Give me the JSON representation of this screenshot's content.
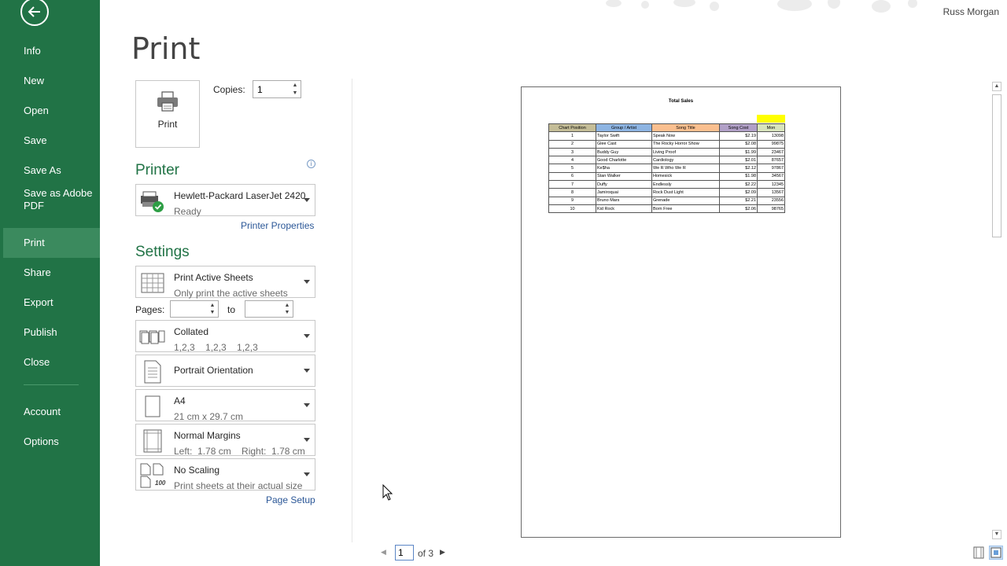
{
  "sidebar": {
    "back_icon": "arrow-left-icon",
    "items": [
      {
        "label": "Info"
      },
      {
        "label": "New"
      },
      {
        "label": "Open"
      },
      {
        "label": "Save"
      },
      {
        "label": "Save As"
      },
      {
        "label": "Save as Adobe PDF"
      },
      {
        "label": "Print"
      },
      {
        "label": "Share"
      },
      {
        "label": "Export"
      },
      {
        "label": "Publish"
      },
      {
        "label": "Close"
      },
      {
        "label": "Account"
      },
      {
        "label": "Options"
      }
    ],
    "active_item": "Print",
    "accent_color": "#217346"
  },
  "header": {
    "title": "Print",
    "user": "Russ Morgan"
  },
  "print_button": {
    "label": "Print",
    "icon": "printer-icon"
  },
  "copies": {
    "label": "Copies:",
    "value": "1"
  },
  "printer": {
    "section_title": "Printer",
    "name": "Hewlett-Packard LaserJet 2420",
    "status": "Ready",
    "properties_link": "Printer Properties"
  },
  "settings": {
    "section_title": "Settings",
    "what_to_print": {
      "title": "Print Active Sheets",
      "subtitle": "Only print the active sheets"
    },
    "pages": {
      "label": "Pages:",
      "to_label": "to",
      "from": "",
      "to": ""
    },
    "collation": {
      "title": "Collated",
      "subtitle": "1,2,3    1,2,3    1,2,3"
    },
    "orientation": {
      "title": "Portrait Orientation"
    },
    "paper": {
      "title": "A4",
      "subtitle": "21 cm x 29.7 cm"
    },
    "margins": {
      "title": "Normal Margins",
      "subtitle": "Left:  1.78 cm    Right:  1.78 cm"
    },
    "scaling": {
      "title": "No Scaling",
      "subtitle": "Print sheets at their actual size",
      "icon_text": "100"
    },
    "page_setup_link": "Page Setup"
  },
  "preview": {
    "sheet_title": "Total Sales",
    "columns": [
      "Chart Position",
      "Group / Artist",
      "Song Title",
      "Song Cost",
      "Mon"
    ],
    "rows": [
      [
        "1",
        "Taylor Swift",
        "Speak Now",
        "$2.19",
        "13098"
      ],
      [
        "2",
        "Glee Cast",
        "The Rocky Horror Show",
        "$2.08",
        "99875"
      ],
      [
        "3",
        "Buddy Guy",
        "Living Proof",
        "$1.99",
        "23467"
      ],
      [
        "4",
        "Good Charlotte",
        "Cardiology",
        "$2.01",
        "87657"
      ],
      [
        "5",
        "Ke$ha",
        "We R Who We R",
        "$2.12",
        "97867"
      ],
      [
        "6",
        "Stan Walker",
        "Homesick",
        "$1.98",
        "34567"
      ],
      [
        "7",
        "Duffy",
        "Endlessly",
        "$2.22",
        "12345"
      ],
      [
        "8",
        "Jamiroquai",
        "Rock Dust Light",
        "$2.09",
        "13567"
      ],
      [
        "9",
        "Bruno Mars",
        "Grenade",
        "$2.21",
        "23556"
      ],
      [
        "10",
        "Kid Rock",
        "Born Free",
        "$2.06",
        "98765"
      ]
    ]
  },
  "pager": {
    "current": "1",
    "of_label": "of 3"
  }
}
